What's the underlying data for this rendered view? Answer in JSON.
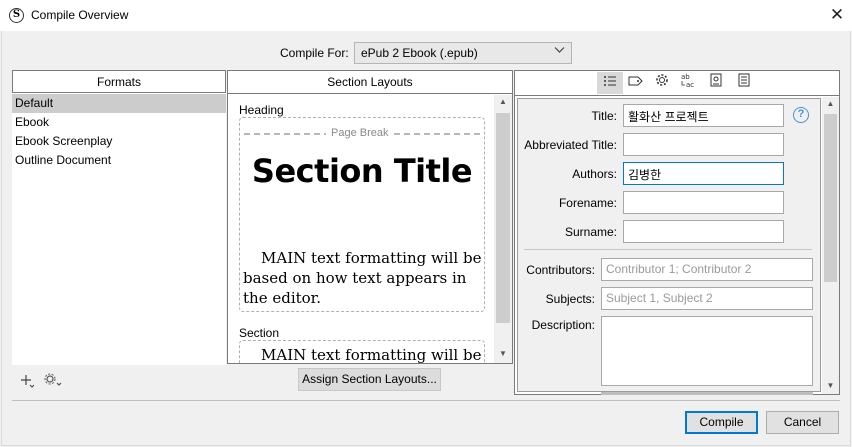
{
  "window": {
    "title": "Compile Overview",
    "app_icon": "S",
    "close_icon": "✕"
  },
  "compile_for": {
    "label": "Compile For:",
    "selected": "ePub 2 Ebook (.epub)"
  },
  "formats": {
    "header": "Formats",
    "items": [
      "Default",
      "Ebook",
      "Ebook Screenplay",
      "Outline Document"
    ],
    "selected_index": 0
  },
  "section_layouts": {
    "header": "Section Layouts",
    "heading": {
      "label": "Heading",
      "page_break": "Page Break",
      "title": "Section Title",
      "body": "MAIN text formatting will be based on how text appears in the editor."
    },
    "section": {
      "label": "Section",
      "body": "MAIN text formatting will be"
    },
    "assign_button": "Assign Section Layouts..."
  },
  "metadata": {
    "tabs": [
      "list-icon",
      "tag-icon",
      "gear-icon",
      "text-replace-icon",
      "image-icon",
      "document-icon"
    ],
    "active_tab": 0,
    "fields": {
      "title": {
        "label": "Title:",
        "value": "활화산 프로젝트"
      },
      "abbreviated_title": {
        "label": "Abbreviated Title:",
        "value": ""
      },
      "authors": {
        "label": "Authors:",
        "value": "김병한"
      },
      "forename": {
        "label": "Forename:",
        "value": ""
      },
      "surname": {
        "label": "Surname:",
        "value": ""
      },
      "contributors": {
        "label": "Contributors:",
        "placeholder": "Contributor 1; Contributor 2"
      },
      "subjects": {
        "label": "Subjects:",
        "placeholder": "Subject 1, Subject 2"
      },
      "description": {
        "label": "Description:",
        "value": ""
      }
    }
  },
  "buttons": {
    "compile": "Compile",
    "cancel": "Cancel"
  }
}
